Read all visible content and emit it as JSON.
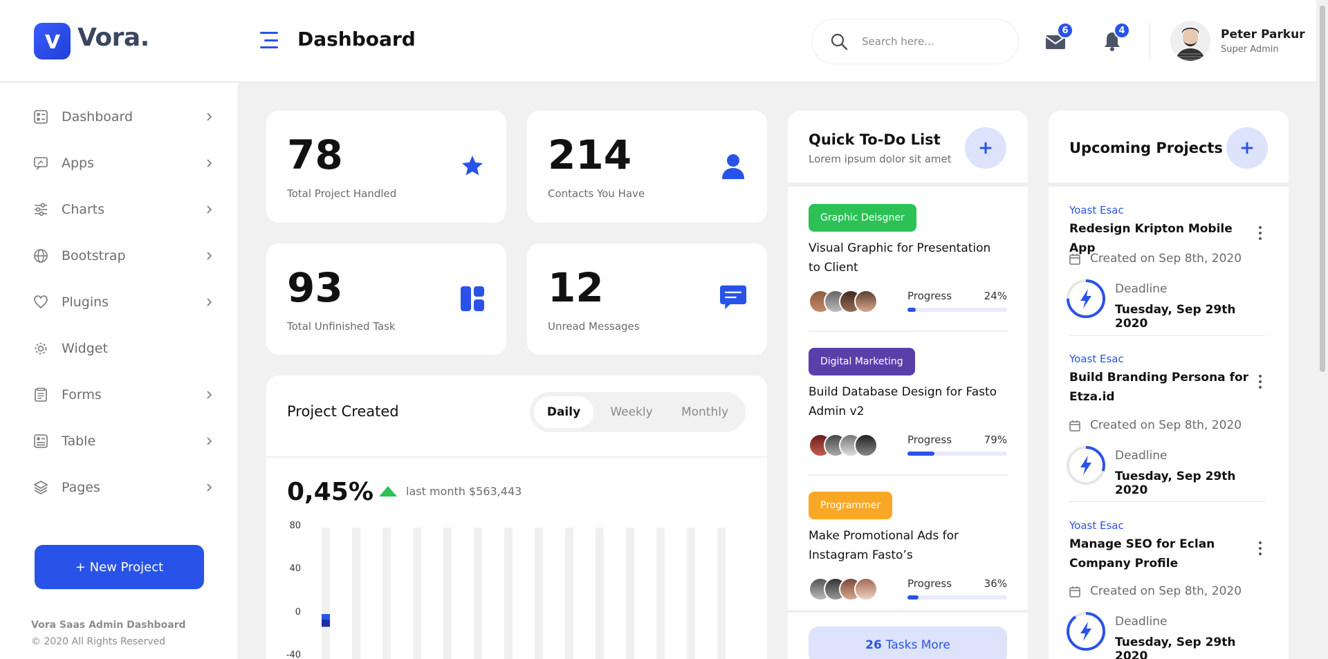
{
  "brand": {
    "logo_letter": "V",
    "name": "Vora."
  },
  "header": {
    "page_title": "Dashboard",
    "search_placeholder": "Search here...",
    "mail_count": "6",
    "notif_count": "4",
    "user_name": "Peter Parkur",
    "user_role": "Super Admin"
  },
  "sidebar": {
    "items": [
      {
        "label": "Dashboard",
        "icon": "dashboard-icon",
        "has_chevron": true
      },
      {
        "label": "Apps",
        "icon": "apps-icon",
        "has_chevron": true
      },
      {
        "label": "Charts",
        "icon": "charts-icon",
        "has_chevron": true
      },
      {
        "label": "Bootstrap",
        "icon": "bootstrap-icon",
        "has_chevron": true
      },
      {
        "label": "Plugins",
        "icon": "plugins-icon",
        "has_chevron": true
      },
      {
        "label": "Widget",
        "icon": "widget-icon",
        "has_chevron": false
      },
      {
        "label": "Forms",
        "icon": "forms-icon",
        "has_chevron": true
      },
      {
        "label": "Table",
        "icon": "table-icon",
        "has_chevron": true
      },
      {
        "label": "Pages",
        "icon": "pages-icon",
        "has_chevron": true
      }
    ],
    "new_project_label": "+ New Project",
    "footer_title": "Vora Saas Admin Dashboard",
    "footer_copy": "© 2020 All Rights Reserved"
  },
  "stats": [
    {
      "value": "78",
      "label": "Total Project Handled",
      "icon": "star-icon"
    },
    {
      "value": "214",
      "label": "Contacts You Have",
      "icon": "user-icon"
    },
    {
      "value": "93",
      "label": "Total Unfinished Task",
      "icon": "layout-icon"
    },
    {
      "value": "12",
      "label": "Unread Messages",
      "icon": "chat-icon"
    }
  ],
  "project_created": {
    "title": "Project Created",
    "tabs": [
      "Daily",
      "Weekly",
      "Monthly"
    ],
    "active_tab": "Daily",
    "percent": "0,45%",
    "trend": "up",
    "last_month": "last month $563,443"
  },
  "chart_data": {
    "type": "bar",
    "title": "",
    "xlabel": "",
    "ylabel": "",
    "ylim": [
      -40,
      80
    ],
    "yticks": [
      "80",
      "40",
      "0",
      "-40"
    ],
    "bar_count": 14,
    "series": [
      {
        "values": [
          0,
          null,
          null,
          null,
          null,
          null,
          null,
          null,
          null,
          null,
          null,
          null,
          null,
          null
        ]
      }
    ],
    "highlight_value_range": [
      -6,
      5
    ],
    "colors": {
      "bar": "#2953e8",
      "track": "#f0f0f0"
    }
  },
  "todo": {
    "title": "Quick To-Do List",
    "subtitle": "Lorem ipsum dolor sit amet",
    "items": [
      {
        "tag": "Graphic Deisgner",
        "tag_color": "#2bc155",
        "name": "Visual Graphic for Presentation to Client",
        "progress_label": "Progress",
        "progress": "24%",
        "progress_value": 0.08
      },
      {
        "tag": "Digital Marketing",
        "tag_color": "#5a3eaa",
        "name": "Build Database Design for Fasto Admin v2",
        "progress_label": "Progress",
        "progress": "79%",
        "progress_value": 0.27
      },
      {
        "tag": "Programmer",
        "tag_color": "#f9a825",
        "name": "Make Promotional Ads for Instagram Fasto’s",
        "progress_label": "Progress",
        "progress": "36%",
        "progress_value": 0.11
      }
    ],
    "more_count": "26",
    "more_label": "Tasks More"
  },
  "upcoming": {
    "title": "Upcoming Projects",
    "projects": [
      {
        "client": "Yoast Esac",
        "name": "Redesign Kripton Mobile App",
        "created": "Created on Sep 8th, 2020",
        "deadline_label": "Deadline",
        "deadline": "Tuesday, Sep 29th 2020",
        "ring": 0.75
      },
      {
        "client": "Yoast Esac",
        "name": "Build Branding Persona for Etza.id",
        "created": "Created on Sep 8th, 2020",
        "deadline_label": "Deadline",
        "deadline": "Tuesday, Sep 29th 2020",
        "ring": 0.3
      },
      {
        "client": "Yoast Esac",
        "name": "Manage SEO for Eclan Company Profile",
        "created": "Created on Sep 8th, 2020",
        "deadline_label": "Deadline",
        "deadline": "Tuesday, Sep 29th 2020",
        "ring": 0.9
      }
    ]
  },
  "colors": {
    "accent": "#2953e8",
    "accent_soft": "#dde3fb",
    "success": "#2bc155"
  }
}
